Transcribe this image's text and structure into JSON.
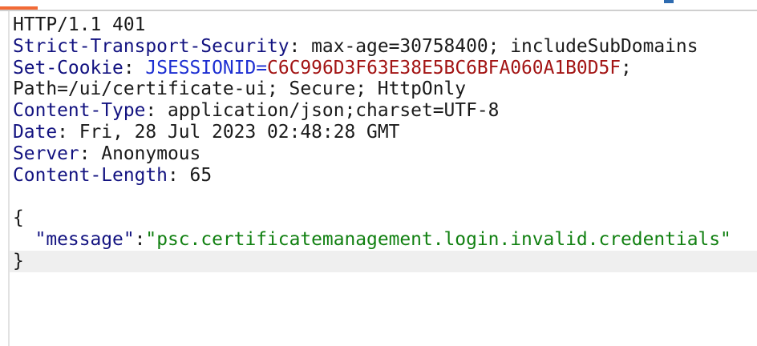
{
  "response": {
    "status_line": "HTTP/1.1 401",
    "headers": [
      {
        "name": "Strict-Transport-Security",
        "value": "max-age=30758400; includeSubDomains"
      },
      {
        "name": "Content-Type",
        "value": "application/json;charset=UTF-8"
      },
      {
        "name": "Date",
        "value": "Fri, 28 Jul 2023 02:48:28 GMT"
      },
      {
        "name": "Server",
        "value": "Anonymous"
      },
      {
        "name": "Content-Length",
        "value": "65"
      }
    ],
    "set_cookie": {
      "name": "Set-Cookie",
      "cookie_name": "JSESSIONID",
      "cookie_value": "C6C996D3F63E38E5BC6BFA060A1B0D5F",
      "attributes": "Path=/ui/certificate-ui; Secure; HttpOnly"
    },
    "body": {
      "open_brace": "{",
      "key": "\"message\"",
      "value": "\"psc.certificatemanagement.login.invalid.credentials\"",
      "close_brace": "}"
    }
  },
  "colors": {
    "accent_tab": "#f26a36",
    "header_name": "#121280",
    "cookie_name": "#1d2fd2",
    "cookie_value": "#a31515",
    "json_string": "#118011"
  }
}
